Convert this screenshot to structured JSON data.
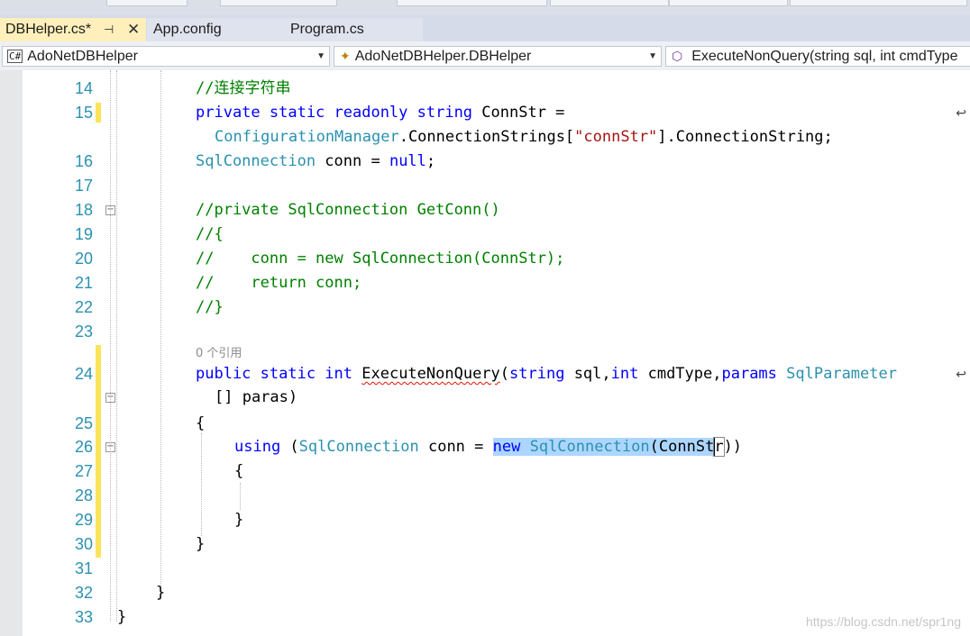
{
  "tabs": [
    {
      "label": "DBHelper.cs*",
      "active": true
    },
    {
      "label": "App.config",
      "active": false
    },
    {
      "label": "Program.cs",
      "active": false
    }
  ],
  "nav": {
    "project": "AdoNetDBHelper",
    "project_icon": "C#",
    "type": "AdoNetDBHelper.DBHelper",
    "member": "ExecuteNonQuery(string sql, int cmdType"
  },
  "lines": {
    "l14": "14",
    "l15": "15",
    "l16": "16",
    "l17": "17",
    "l18": "18",
    "l19": "19",
    "l20": "20",
    "l21": "21",
    "l22": "22",
    "l23": "23",
    "l24": "24",
    "l25": "25",
    "l26": "26",
    "l27": "27",
    "l28": "28",
    "l29": "29",
    "l30": "30",
    "l31": "31",
    "l32": "32",
    "l33": "33"
  },
  "code": {
    "c14": "//连接字符串",
    "c15_kw": "private static readonly string",
    "c15_rest": " ConnStr =",
    "c15b_type": "ConfigurationManager",
    "c15b_mid": ".ConnectionStrings[",
    "c15b_str": "\"connStr\"",
    "c15b_end": "].ConnectionString;",
    "c16_type": "SqlConnection",
    "c16_var": " conn = ",
    "c16_null": "null",
    "c16_end": ";",
    "c18": "//private SqlConnection GetConn()",
    "c19": "//{",
    "c20": "//    conn = new SqlConnection(ConnStr);",
    "c21": "//    return conn;",
    "c22": "//}",
    "c24_lens": "0 个引用",
    "c24_kw": "public static int",
    "c24_sp": " ",
    "c24_method": "ExecuteNonQuery",
    "c24_open": "(",
    "c24_string": "string",
    "c24_sql": " sql,",
    "c24_int": "int",
    "c24_cmd": " cmdType,",
    "c24_params": "params",
    "c24_sp2": " ",
    "c24_sqlparam": "SqlParameter",
    "c24b": "[] paras)",
    "c25": "{",
    "c26_using": "using",
    "c26_open": " (",
    "c26_type": "SqlConnection",
    "c26_var": " conn = ",
    "c26_new": "new",
    "c26_sp": " ",
    "c26_type2": "SqlConnection",
    "c26_args1": "(ConnSt",
    "c26_args2": "r",
    "c26_close": "))",
    "c27": "{",
    "c29": "}",
    "c30": "}",
    "c32": "}",
    "c33": "}"
  },
  "wrap_glyph": "↩",
  "watermark": "https://blog.csdn.net/spr1ng"
}
